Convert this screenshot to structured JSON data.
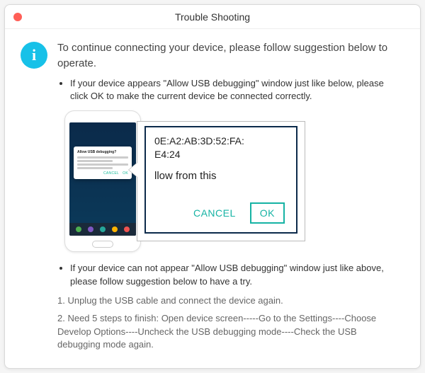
{
  "window": {
    "title": "Trouble Shooting"
  },
  "lead": "To continue connecting your device, please follow suggestion below to operate.",
  "bullets": {
    "first": "If your device appears \"Allow USB debugging\" window just like below, please click OK to make the current device  be connected correctly.",
    "second": "If your device can not appear \"Allow USB debugging\" window just like above, please follow suggestion below to have a try."
  },
  "phone_dialog": {
    "title": "Allow USB debugging?",
    "cancel": "CANCEL",
    "ok": "OK"
  },
  "zoom": {
    "mac_line1": "0E:A2:AB:3D:52:FA:",
    "mac_line2": "E4:24",
    "allow_text": "llow from this",
    "cancel": "CANCEL",
    "ok": "OK"
  },
  "steps": {
    "s1": "1. Unplug the USB cable and connect the device again.",
    "s2": "2. Need 5 steps to finish: Open device screen-----Go to the Settings----Choose Develop Options----Uncheck the USB debugging mode----Check the USB debugging mode again."
  }
}
